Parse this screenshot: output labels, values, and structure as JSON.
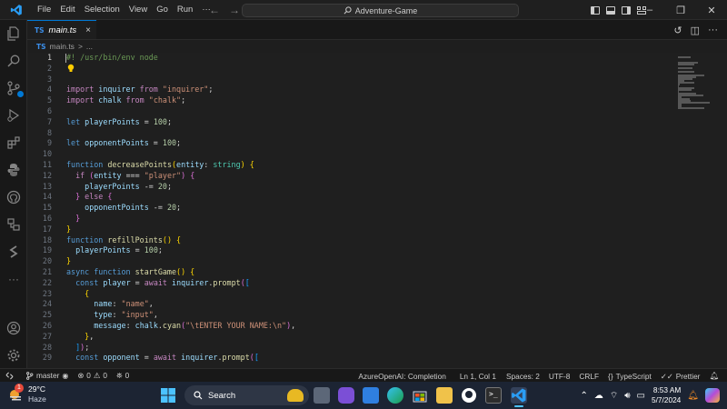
{
  "titlebar": {
    "menu": [
      "File",
      "Edit",
      "Selection",
      "View",
      "Go",
      "Run",
      "···"
    ],
    "command_center": "Adventure-Game"
  },
  "tab": {
    "label": "main.ts",
    "badge": "TS",
    "close": "×"
  },
  "breadcrumb": {
    "file": "main.ts",
    "separator": ">",
    "tail": "..."
  },
  "editor": {
    "active_line": 1,
    "lines": [
      {
        "n": "1",
        "tokens": [
          [
            "cm",
            "#! /usr/bin/env node"
          ]
        ]
      },
      {
        "n": "2",
        "tokens": []
      },
      {
        "n": "3",
        "tokens": []
      },
      {
        "n": "4",
        "tokens": [
          [
            "ctl",
            "import "
          ],
          [
            "var",
            "inquirer"
          ],
          [
            "ctl",
            " from "
          ],
          [
            "str",
            "\"inquirer\""
          ],
          [
            "pl",
            ";"
          ]
        ]
      },
      {
        "n": "5",
        "tokens": [
          [
            "ctl",
            "import "
          ],
          [
            "var",
            "chalk"
          ],
          [
            "ctl",
            " from "
          ],
          [
            "str",
            "\"chalk\""
          ],
          [
            "pl",
            ";"
          ]
        ]
      },
      {
        "n": "6",
        "tokens": []
      },
      {
        "n": "7",
        "tokens": [
          [
            "kw",
            "let "
          ],
          [
            "var",
            "playerPoints"
          ],
          [
            "pl",
            " = "
          ],
          [
            "num",
            "100"
          ],
          [
            "pl",
            ";"
          ]
        ]
      },
      {
        "n": "8",
        "tokens": []
      },
      {
        "n": "9",
        "tokens": [
          [
            "kw",
            "let "
          ],
          [
            "var",
            "opponentPoints"
          ],
          [
            "pl",
            " = "
          ],
          [
            "num",
            "100"
          ],
          [
            "pl",
            ";"
          ]
        ]
      },
      {
        "n": "10",
        "tokens": []
      },
      {
        "n": "11",
        "tokens": [
          [
            "kw",
            "function "
          ],
          [
            "fn",
            "decreasePoints"
          ],
          [
            "br1",
            "("
          ],
          [
            "var",
            "entity"
          ],
          [
            "pl",
            ": "
          ],
          [
            "type",
            "string"
          ],
          [
            "br1",
            ")"
          ],
          [
            "pl",
            " "
          ],
          [
            "br1",
            "{"
          ]
        ]
      },
      {
        "n": "12",
        "tokens": [
          [
            "pl",
            "  "
          ],
          [
            "ctl",
            "if "
          ],
          [
            "br2",
            "("
          ],
          [
            "var",
            "entity"
          ],
          [
            "pl",
            " === "
          ],
          [
            "str",
            "\"player\""
          ],
          [
            "br2",
            ")"
          ],
          [
            "pl",
            " "
          ],
          [
            "br2",
            "{"
          ]
        ]
      },
      {
        "n": "13",
        "tokens": [
          [
            "pl",
            "    "
          ],
          [
            "var",
            "playerPoints"
          ],
          [
            "pl",
            " -= "
          ],
          [
            "num",
            "20"
          ],
          [
            "pl",
            ";"
          ]
        ]
      },
      {
        "n": "14",
        "tokens": [
          [
            "pl",
            "  "
          ],
          [
            "br2",
            "}"
          ],
          [
            "ctl",
            " else "
          ],
          [
            "br2",
            "{"
          ]
        ]
      },
      {
        "n": "15",
        "tokens": [
          [
            "pl",
            "    "
          ],
          [
            "var",
            "opponentPoints"
          ],
          [
            "pl",
            " -= "
          ],
          [
            "num",
            "20"
          ],
          [
            "pl",
            ";"
          ]
        ]
      },
      {
        "n": "16",
        "tokens": [
          [
            "pl",
            "  "
          ],
          [
            "br2",
            "}"
          ]
        ]
      },
      {
        "n": "17",
        "tokens": [
          [
            "br1",
            "}"
          ]
        ]
      },
      {
        "n": "18",
        "tokens": [
          [
            "kw",
            "function "
          ],
          [
            "fn",
            "refillPoints"
          ],
          [
            "br1",
            "()"
          ],
          [
            "pl",
            " "
          ],
          [
            "br1",
            "{"
          ]
        ]
      },
      {
        "n": "19",
        "tokens": [
          [
            "pl",
            "  "
          ],
          [
            "var",
            "playerPoints"
          ],
          [
            "pl",
            " = "
          ],
          [
            "num",
            "100"
          ],
          [
            "pl",
            ";"
          ]
        ]
      },
      {
        "n": "20",
        "tokens": [
          [
            "br1",
            "}"
          ]
        ]
      },
      {
        "n": "21",
        "tokens": [
          [
            "kw",
            "async function "
          ],
          [
            "fn",
            "startGame"
          ],
          [
            "br1",
            "()"
          ],
          [
            "pl",
            " "
          ],
          [
            "br1",
            "{"
          ]
        ]
      },
      {
        "n": "22",
        "tokens": [
          [
            "pl",
            "  "
          ],
          [
            "kw",
            "const "
          ],
          [
            "var",
            "player"
          ],
          [
            "pl",
            " = "
          ],
          [
            "ctl",
            "await "
          ],
          [
            "var",
            "inquirer"
          ],
          [
            "pl",
            "."
          ],
          [
            "fn",
            "prompt"
          ],
          [
            "br2",
            "("
          ],
          [
            "br3",
            "["
          ]
        ]
      },
      {
        "n": "23",
        "tokens": [
          [
            "pl",
            "    "
          ],
          [
            "br1",
            "{"
          ]
        ]
      },
      {
        "n": "24",
        "tokens": [
          [
            "pl",
            "      "
          ],
          [
            "var",
            "name"
          ],
          [
            "pl",
            ": "
          ],
          [
            "str",
            "\"name\""
          ],
          [
            "pl",
            ","
          ]
        ]
      },
      {
        "n": "25",
        "tokens": [
          [
            "pl",
            "      "
          ],
          [
            "var",
            "type"
          ],
          [
            "pl",
            ": "
          ],
          [
            "str",
            "\"input\""
          ],
          [
            "pl",
            ","
          ]
        ]
      },
      {
        "n": "26",
        "tokens": [
          [
            "pl",
            "      "
          ],
          [
            "var",
            "message"
          ],
          [
            "pl",
            ": "
          ],
          [
            "var",
            "chalk"
          ],
          [
            "pl",
            "."
          ],
          [
            "fn",
            "cyan"
          ],
          [
            "br2",
            "("
          ],
          [
            "str",
            "\"\\tENTER YOUR NAME:\\n\""
          ],
          [
            "br2",
            ")"
          ],
          [
            "pl",
            ","
          ]
        ]
      },
      {
        "n": "27",
        "tokens": [
          [
            "pl",
            "    "
          ],
          [
            "br1",
            "}"
          ],
          [
            "pl",
            ","
          ]
        ]
      },
      {
        "n": "28",
        "tokens": [
          [
            "pl",
            "  "
          ],
          [
            "br3",
            "]"
          ],
          [
            "br2",
            ")"
          ],
          [
            "pl",
            ";"
          ]
        ]
      },
      {
        "n": "29",
        "tokens": [
          [
            "pl",
            "  "
          ],
          [
            "kw",
            "const "
          ],
          [
            "var",
            "opponent"
          ],
          [
            "pl",
            " = "
          ],
          [
            "ctl",
            "await "
          ],
          [
            "var",
            "inquirer"
          ],
          [
            "pl",
            "."
          ],
          [
            "fn",
            "prompt"
          ],
          [
            "br2",
            "("
          ],
          [
            "br3",
            "["
          ]
        ]
      }
    ]
  },
  "statusbar": {
    "branch": "master",
    "errors": "0",
    "warnings": "0",
    "ports": "0",
    "completion": "AzureOpenAI: Completion",
    "position": "Ln 1, Col 1",
    "spaces": "Spaces: 2",
    "encoding": "UTF-8",
    "eol": "CRLF",
    "language": "TypeScript",
    "formatter": "Prettier"
  },
  "taskbar": {
    "weather_temp": "29°C",
    "weather_desc": "Haze",
    "weather_badge": "1",
    "search_label": "Search",
    "time": "8:53 AM",
    "date": "5/7/2024"
  },
  "colors": {
    "accent": "#0078d4",
    "editor_bg": "#1f1f1f",
    "taskbar_bg": "#1c2433"
  }
}
